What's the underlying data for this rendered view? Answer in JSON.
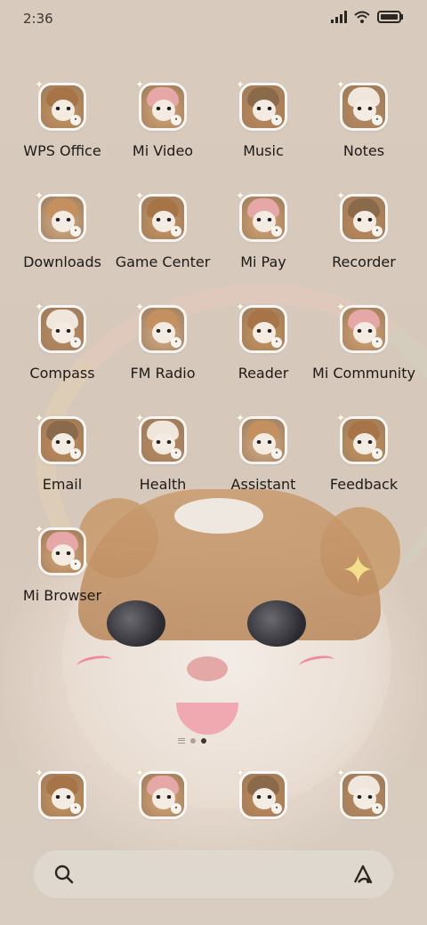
{
  "status_bar": {
    "time": "2:36",
    "signal_icon": "signal-icon",
    "wifi_icon": "wifi-icon",
    "battery_icon": "battery-icon"
  },
  "apps": [
    {
      "label": "WPS Office",
      "icon": "wps-office-icon"
    },
    {
      "label": "Mi Video",
      "icon": "mi-video-icon"
    },
    {
      "label": "Music",
      "icon": "music-icon"
    },
    {
      "label": "Notes",
      "icon": "notes-icon"
    },
    {
      "label": "Downloads",
      "icon": "downloads-icon"
    },
    {
      "label": "Game Center",
      "icon": "game-center-icon"
    },
    {
      "label": "Mi Pay",
      "icon": "mi-pay-icon"
    },
    {
      "label": "Recorder",
      "icon": "recorder-icon"
    },
    {
      "label": "Compass",
      "icon": "compass-icon"
    },
    {
      "label": "FM Radio",
      "icon": "fm-radio-icon"
    },
    {
      "label": "Reader",
      "icon": "reader-icon"
    },
    {
      "label": "Mi Community",
      "icon": "mi-community-icon"
    },
    {
      "label": "Email",
      "icon": "email-icon"
    },
    {
      "label": "Health",
      "icon": "health-icon"
    },
    {
      "label": "Assistant",
      "icon": "assistant-icon"
    },
    {
      "label": "Feedback",
      "icon": "feedback-icon"
    },
    {
      "label": "Mi Browser",
      "icon": "mi-browser-icon"
    }
  ],
  "dock": [
    {
      "icon": "phone-icon"
    },
    {
      "icon": "messages-icon"
    },
    {
      "icon": "browser-icon"
    },
    {
      "icon": "camera-icon"
    }
  ],
  "page_indicator": {
    "pages": 2,
    "active": 1
  },
  "search_bar": {
    "search_icon": "search-icon",
    "assistant_icon": "assistant-icon"
  },
  "colors": {
    "accent": "#3e3530",
    "label_text": "#1e1a17",
    "tile_fur": "#c8965f"
  }
}
